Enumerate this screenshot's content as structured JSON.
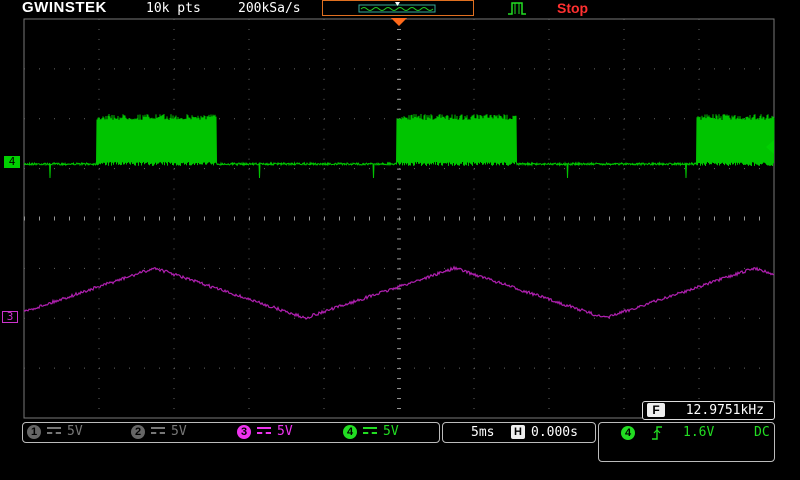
{
  "header": {
    "logo": "GWINSTEK",
    "record_length": "10k pts",
    "sample_rate": "200kSa/s",
    "run_state": "Stop"
  },
  "colors": {
    "ch3": "#cc33cc",
    "ch4": "#00cc00",
    "grid": "#888888",
    "stop": "#ff3030",
    "trigger_marker": "#ff6a1a"
  },
  "markers": {
    "ch4": "4",
    "ch3": "3"
  },
  "measurement": {
    "icon": "F",
    "frequency": "12.9751kHz"
  },
  "channels": [
    {
      "num": "1",
      "scale": "5V",
      "active": false,
      "color": "#777777"
    },
    {
      "num": "2",
      "scale": "5V",
      "active": false,
      "color": "#777777"
    },
    {
      "num": "3",
      "scale": "5V",
      "active": true,
      "color": "#ee33ee"
    },
    {
      "num": "4",
      "scale": "5V",
      "active": true,
      "color": "#22dd22"
    }
  ],
  "timebase": {
    "scale": "5ms",
    "h_icon": "H",
    "position": "0.000s"
  },
  "trigger": {
    "source": "4",
    "level": "1.6V",
    "coupling": "DC"
  },
  "chart_data": {
    "type": "line",
    "series": [
      {
        "name": "4",
        "shape": "burst-square",
        "period_divs": 4.0,
        "on_divs": 1.6
      },
      {
        "name": "3",
        "shape": "triangle",
        "period_divs": 4.0
      }
    ]
  }
}
